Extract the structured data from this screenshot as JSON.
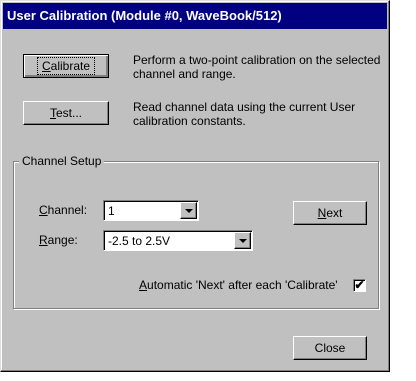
{
  "window": {
    "title": "User Calibration (Module #0, WaveBook/512)"
  },
  "calibrate": {
    "label_mnemonic": "C",
    "label_rest": "alibrate",
    "description": "Perform a two-point calibration on the selected channel and range."
  },
  "test": {
    "label_mnemonic": "T",
    "label_rest": "est...",
    "description": "Read channel data using the current User calibration constants."
  },
  "channel_setup": {
    "group_label": "Channel Setup",
    "channel_label_mnemonic": "C",
    "channel_label_rest": "hannel:",
    "channel_value": "1",
    "range_label_mnemonic": "R",
    "range_label_rest": "ange:",
    "range_value": "-2.5 to 2.5V",
    "next_label_mnemonic": "N",
    "next_label_rest": "ext",
    "auto_next_mnemonic": "A",
    "auto_next_rest": "utomatic 'Next' after each 'Calibrate'",
    "auto_next_checked": "✔"
  },
  "close_label": "Close",
  "icons": {
    "dropdown": "chevron-down-icon",
    "checkbox": "checkbox-checked-icon"
  },
  "colors": {
    "titlebar": "#000080",
    "face": "#c0c0c0"
  }
}
